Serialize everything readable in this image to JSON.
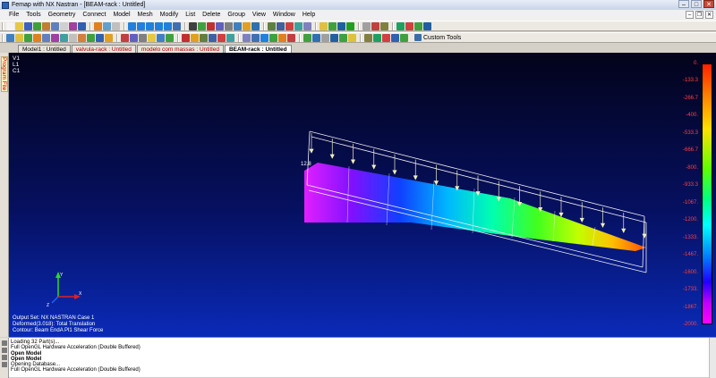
{
  "window": {
    "title": "Femap with NX Nastran - [BEAM-rack : Untitled]"
  },
  "menu": [
    "File",
    "Tools",
    "Geometry",
    "Connect",
    "Model",
    "Mesh",
    "Modify",
    "List",
    "Delete",
    "Group",
    "View",
    "Window",
    "Help"
  ],
  "toolbar": {
    "custom_tools_label": "Custom Tools",
    "icon_colors_row1": [
      "#f4f4f4",
      "#e8c840",
      "#4060c0",
      "#40a040",
      "#c08030",
      "#6080c0",
      "#d0d0d0",
      "#a040a0",
      "#3060b0",
      "#e08020",
      "#60a0d0",
      "#c0c0c0",
      "#2080e0",
      "#2080e0",
      "#2080e0",
      "#2080e0",
      "#2080e0",
      "#4070b0",
      "#404040",
      "#40a040",
      "#c03030",
      "#6060c0",
      "#808080",
      "#4080c0",
      "#e0a020",
      "#3070b0",
      "#608040",
      "#4060a0",
      "#d04040",
      "#40a0a0",
      "#8080c0",
      "#e0c040",
      "#40a040",
      "#2060a0",
      "#20a020",
      "#a0a0a0",
      "#c04040",
      "#808040",
      "#20a060",
      "#d04040",
      "#40a040",
      "#2060a0"
    ],
    "icon_colors_row2": [
      "#4080c0",
      "#e0c040",
      "#40a040",
      "#e08020",
      "#6080c0",
      "#a040a0",
      "#40a0a0",
      "#c0c0c0",
      "#d08040",
      "#40a040",
      "#3060b0",
      "#e0a020",
      "#c04040",
      "#6060c0",
      "#808080",
      "#e8c840",
      "#4080c0",
      "#40a040",
      "#c03030",
      "#e0a020",
      "#608040",
      "#4060a0",
      "#d04040",
      "#40a0a0",
      "#8080c0",
      "#4070b0",
      "#2080e0",
      "#40a040",
      "#e08020",
      "#c04040",
      "#40a040",
      "#3070b0",
      "#a0a0a0",
      "#2060a0",
      "#40a040",
      "#e0c040",
      "#808040",
      "#20a060",
      "#d04040",
      "#3060b0",
      "#40a040"
    ]
  },
  "tabs": [
    {
      "label": "Model1 : Untitled",
      "color": "normal"
    },
    {
      "label": "valvula-rack : Untitled",
      "color": "red"
    },
    {
      "label": "modelo com massas : Untitled",
      "color": "red"
    },
    {
      "label": "BEAM-rack : Untitled",
      "color": "active"
    }
  ],
  "side_panel": {
    "label": "Program File"
  },
  "viewport": {
    "view_labels": [
      "V1",
      "L1",
      "C1"
    ],
    "node_label": "12.8",
    "legend": [
      "Output Set: NX NASTRAN Case 1",
      "Deformed(3.018): Total Translation",
      "Contour: Beam EndA Pl1 Shear Force"
    ],
    "colorbar_labels": [
      "0.",
      "-133.3",
      "-266.7",
      "-400.",
      "-533.3",
      "-666.7",
      "-800.",
      "-933.3",
      "-1067.",
      "-1200.",
      "-1333.",
      "-1467.",
      "-1600.",
      "-1733.",
      "-1867.",
      "-2000."
    ]
  },
  "messages": [
    {
      "text": "Loading 32 Part(s)...",
      "bold": false
    },
    {
      "text": "Full OpenGL Hardware Acceleration (Double Buffered)",
      "bold": false
    },
    {
      "text": "Open Model",
      "bold": true
    },
    {
      "text": "Open Model",
      "bold": true
    },
    {
      "text": "Opening Database...",
      "bold": false
    },
    {
      "text": "Full OpenGL Hardware Acceleration (Double Buffered)",
      "bold": false
    }
  ]
}
